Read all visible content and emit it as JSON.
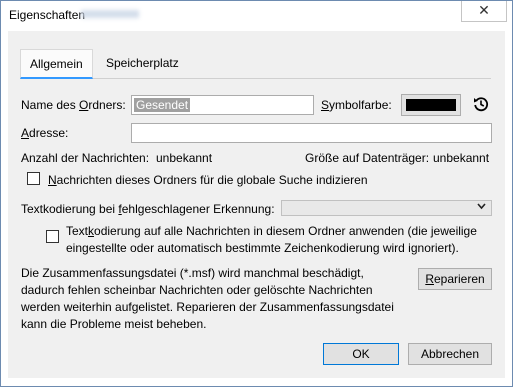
{
  "window": {
    "title": "Eigenschaften",
    "close_glyph": "✕"
  },
  "tabs": [
    {
      "label": "Allgemein",
      "active": true
    },
    {
      "label": "Speicherplatz",
      "active": false
    }
  ],
  "name": {
    "label_pre": "Name des ",
    "label_ul": "O",
    "label_post": "rdners:",
    "value": "Gesendet"
  },
  "symbolfarbe": {
    "label_pre": "",
    "label_ul": "S",
    "label_post": "ymbolfarbe:",
    "color": "#000000",
    "restore_icon": "restore-default-icon"
  },
  "adresse": {
    "label_pre": "",
    "label_ul": "A",
    "label_post": "dresse:",
    "value": ""
  },
  "stats": {
    "count_label": "Anzahl der Nachrichten:",
    "count_value": "unbekannt",
    "size_label": "Größe auf Datenträger:",
    "size_value": "unbekannt"
  },
  "index_checkbox": {
    "label_pre": "",
    "label_ul": "N",
    "label_post": "achrichten dieses Ordners für die globale Suche indizieren",
    "checked": false
  },
  "textkodierung": {
    "label_pre": "Textkodierung bei ",
    "label_ul": "f",
    "label_post": "ehlgeschlagener Erkennung:",
    "selected": ""
  },
  "apply_checkbox": {
    "line1_pre": "Text",
    "line1_ul": "k",
    "line1_post": "odierung auf alle Nachrichten in diesem Ordner anwenden (die jeweilige",
    "line2": "eingestellte oder automatisch bestimmte Zeichenkodierung wird ignoriert).",
    "checked": false
  },
  "repair_info": [
    "Die Zusammenfassungsdatei (*.msf) wird manchmal beschädigt,",
    "dadurch fehlen scheinbar Nachrichten oder gelöschte Nachrichten",
    "werden weiterhin aufgelistet. Reparieren der Zusammenfassungsdatei",
    "kann die Probleme meist beheben."
  ],
  "buttons": {
    "repair_ul": "R",
    "repair_post": "eparieren",
    "ok": "OK",
    "cancel": "Abbrechen"
  }
}
